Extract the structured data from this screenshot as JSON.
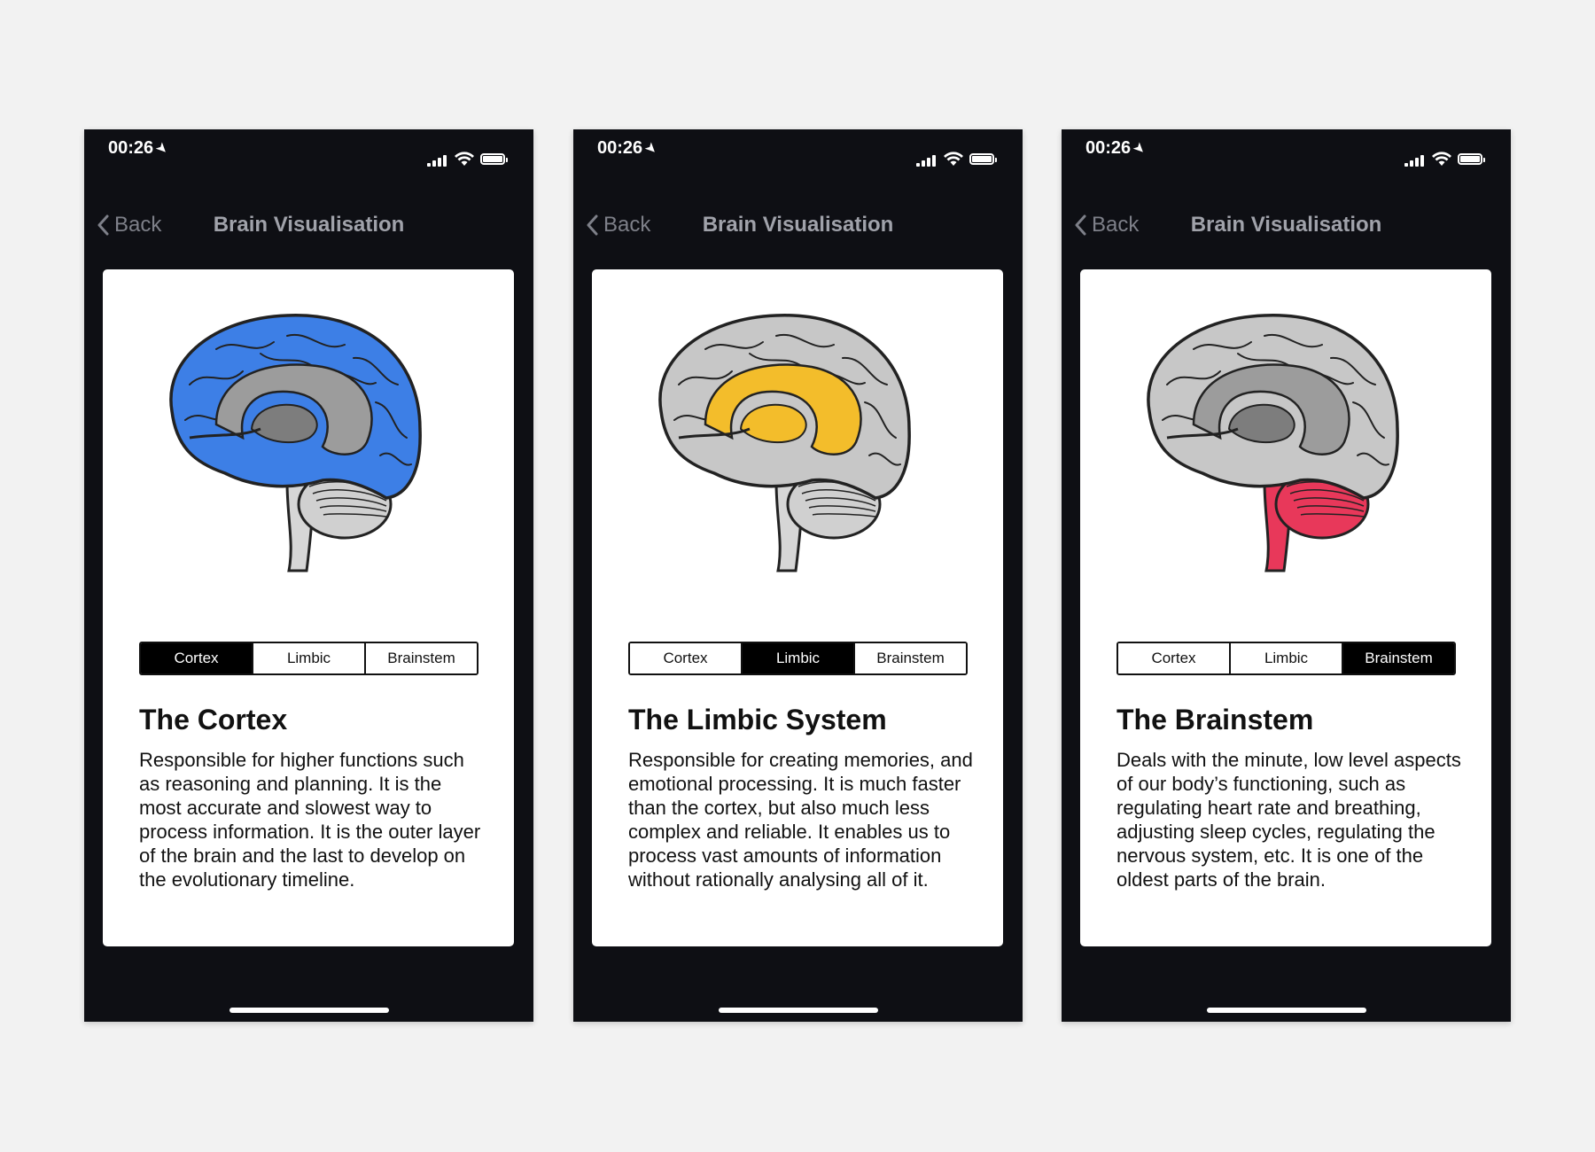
{
  "phones": [
    {
      "status_time": "00:26",
      "back_label": "Back",
      "nav_title": "Brain Visualisation",
      "segments": [
        "Cortex",
        "Limbic",
        "Brainstem"
      ],
      "active_segment": "Cortex",
      "highlight_color": "#3d7fe6",
      "title": "The Cortex",
      "body": "Responsible for higher functions such as reasoning and planning. It is the most accurate and slowest way to process  information. It is the outer layer of the brain and the last to develop on the evolutionary timeline."
    },
    {
      "status_time": "00:26",
      "back_label": "Back",
      "nav_title": "Brain Visualisation",
      "segments": [
        "Cortex",
        "Limbic",
        "Brainstem"
      ],
      "active_segment": "Limbic",
      "highlight_color": "#f3bd2b",
      "title": "The Limbic System",
      "body": "Responsible for creating memories, and emotional processing. It is much faster than the cortex, but also much less complex and reliable. It enables us to process vast amounts of information without rationally analysing all of it."
    },
    {
      "status_time": "00:26",
      "back_label": "Back",
      "nav_title": "Brain Visualisation",
      "segments": [
        "Cortex",
        "Limbic",
        "Brainstem"
      ],
      "active_segment": "Brainstem",
      "highlight_color": "#e8385a",
      "title": "The Brainstem",
      "body": "Deals with the minute, low level aspects of our body’s functioning, such as regulating heart rate and breathing, adjusting sleep cycles, regulating the nervous system, etc. It is one of the oldest parts of the brain."
    }
  ],
  "colors": {
    "phone_background": "#0e0f14",
    "page_background": "#f2f2f2",
    "brain_grey": "#c7c7c7",
    "cortex_blue": "#3d7fe6",
    "limbic_yellow": "#f3bd2b",
    "brainstem_red": "#e8385a"
  },
  "icons": {
    "back": "chevron-left-icon",
    "location": "location-arrow-icon",
    "signal": "cellular-signal-icon",
    "wifi": "wifi-icon",
    "battery": "battery-icon"
  }
}
